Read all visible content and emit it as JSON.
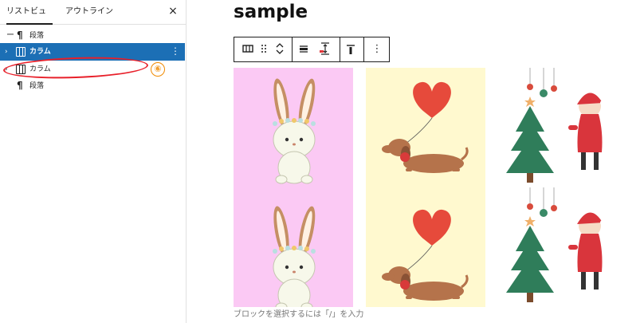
{
  "sidebar": {
    "tabs": [
      {
        "label": "リストビュー",
        "active": true
      },
      {
        "label": "アウトライン",
        "active": false
      }
    ],
    "close_glyph": "×",
    "items": [
      {
        "label": "段落",
        "icon": "pilcrow-icon",
        "selected": false,
        "expandable": false
      },
      {
        "label": "カラム",
        "icon": "columns-icon",
        "selected": true,
        "expandable": true,
        "options_glyph": "⋮"
      },
      {
        "label": "カラム",
        "icon": "columns-icon",
        "selected": false,
        "expandable": true
      },
      {
        "label": "段落",
        "icon": "pilcrow-icon",
        "selected": false,
        "expandable": false
      }
    ],
    "chevron_glyph": "›",
    "pilcrow_glyph": "¶"
  },
  "annotation": {
    "number": "⑥",
    "color": "#e8202a",
    "number_color": "#f08a00"
  },
  "editor": {
    "title": "sample",
    "toolbar": {
      "buttons": [
        "columns-icon",
        "drag-handle-icon",
        "move-up-down-icon",
        "justify-icon",
        "height-icon",
        "vertical-align-top-icon",
        "more-options-icon"
      ],
      "options_glyph": "⋮"
    },
    "columns": [
      {
        "background": "#fbc9f4",
        "image": "rabbit"
      },
      {
        "background": "#fff9cf",
        "image": "dog-with-heart-balloon"
      },
      {
        "background": "#ffffff",
        "image": "christmas-tree-and-girl"
      }
    ],
    "placeholder": "ブロックを選択するには「/」を入力"
  },
  "colors": {
    "selected": "#1c6fb5",
    "accent_border": "#1e1e1e"
  }
}
